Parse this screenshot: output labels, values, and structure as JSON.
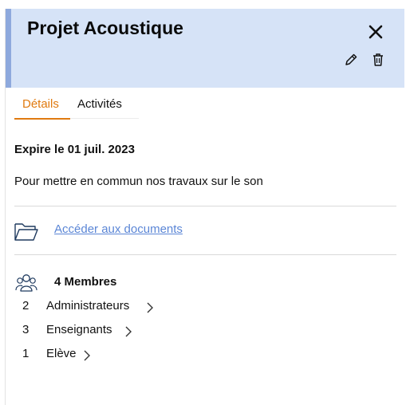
{
  "header": {
    "title": "Projet Acoustique"
  },
  "tabs": [
    {
      "label": "Détails",
      "active": true
    },
    {
      "label": "Activités",
      "active": false
    }
  ],
  "details": {
    "expires": "Expire le 01 juil. 2023",
    "description": "Pour mettre en commun nos travaux sur le son"
  },
  "documents": {
    "link_label": "Accéder aux documents",
    "icon": "folder-icon"
  },
  "members": {
    "title": "4 Membres",
    "icon": "group-icon",
    "roles": [
      {
        "count": "2",
        "label": "Administrateurs"
      },
      {
        "count": "3",
        "label": "Enseignants"
      },
      {
        "count": "1",
        "label": "Elève"
      }
    ]
  },
  "colors": {
    "header_bg": "#d6e3f7",
    "header_accent": "#8ea9dd",
    "active_tab": "#e07a10",
    "link": "#5b86d6"
  }
}
